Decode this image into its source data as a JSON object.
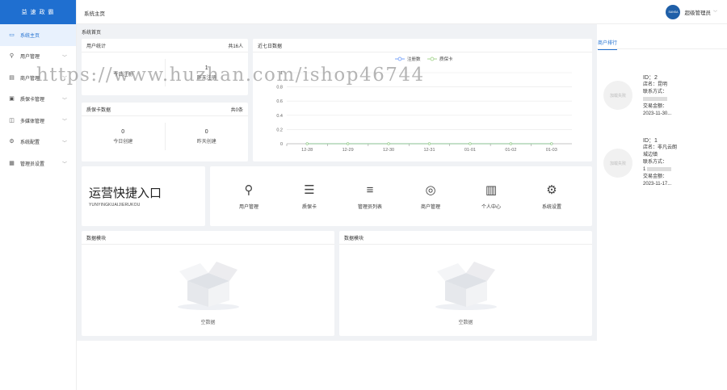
{
  "app": {
    "logo_text": "益 速 政 霸"
  },
  "sidebar": {
    "items": [
      {
        "label": "系统主页",
        "icon": "monitor-icon",
        "active": true
      },
      {
        "label": "用户管理",
        "icon": "user-icon",
        "chevron": true
      },
      {
        "label": "商户管理",
        "icon": "store-icon",
        "chevron": true
      },
      {
        "label": "质保卡管理",
        "icon": "card-icon",
        "chevron": true
      },
      {
        "label": "多媒体管理",
        "icon": "media-icon",
        "chevron": true
      },
      {
        "label": "系统配置",
        "icon": "settings-icon",
        "chevron": true
      },
      {
        "label": "管理员设置",
        "icon": "admin-icon",
        "chevron": true
      }
    ]
  },
  "header": {
    "breadcrumb": "系统主页",
    "user_name": "超级管理员",
    "avatar_text": "SANSA"
  },
  "main": {
    "page_label": "系统首页",
    "user_stats": {
      "title": "用户统计",
      "total": "共16人",
      "left_num": "",
      "left_label": "今日注册",
      "right_num": "1",
      "right_label": "昨天注册"
    },
    "warranty_stats": {
      "title": "质保卡数据",
      "total": "共0条",
      "left_num": "0",
      "left_label": "今日创建",
      "right_num": "0",
      "right_label": "昨天创建"
    },
    "chart_card_title": "近七日数据",
    "quick": {
      "title": "运营快捷入口",
      "subtitle": "YUNYINGKUAIJIERUKOU",
      "items": [
        {
          "label": "用户管理",
          "icon": "user-icon"
        },
        {
          "label": "质保卡",
          "icon": "document-icon"
        },
        {
          "label": "管理员列表",
          "icon": "sliders-icon"
        },
        {
          "label": "商户管理",
          "icon": "lifebuoy-icon"
        },
        {
          "label": "个人中心",
          "icon": "profile-card-icon"
        },
        {
          "label": "系统设置",
          "icon": "gear-icon"
        }
      ]
    },
    "data_panels": [
      {
        "title": "数据模块",
        "empty_text": "空数据"
      },
      {
        "title": "数据模块",
        "empty_text": "空数据"
      }
    ]
  },
  "right": {
    "tab": "商户排行",
    "merchants": [
      {
        "img_text": "加载失败",
        "id": "ID：2",
        "store": "店名：昆明",
        "contact_label": "联系方式：",
        "phone": "",
        "amount_label": "交易金额：",
        "date": "2023-11-30..."
      },
      {
        "img_text": "加载失败",
        "id": "ID：1",
        "store": "店名：非凡云朗",
        "address": "城边镇",
        "contact_label": "联系方式：",
        "phone": "1",
        "amount_label": "交易金额：",
        "date": "2023-11-17..."
      }
    ]
  },
  "watermark": "https://www.huzhan.com/ishop46744",
  "chart_data": {
    "type": "line",
    "title": "近七日数据",
    "categories": [
      "12-28",
      "12-29",
      "12-30",
      "12-31",
      "01-01",
      "01-02",
      "01-03"
    ],
    "series": [
      {
        "name": "注册数",
        "values": [
          0,
          0,
          0,
          0,
          0,
          0,
          0
        ],
        "color": "#5b8ff9"
      },
      {
        "name": "质保卡",
        "values": [
          0,
          0,
          0,
          0,
          0,
          0,
          0
        ],
        "color": "#91cc75"
      }
    ],
    "yticks": [
      0,
      0.2,
      0.4,
      0.6,
      0.8,
      1
    ],
    "ylim": [
      0,
      1
    ],
    "legend": "top-center",
    "grid": true
  }
}
